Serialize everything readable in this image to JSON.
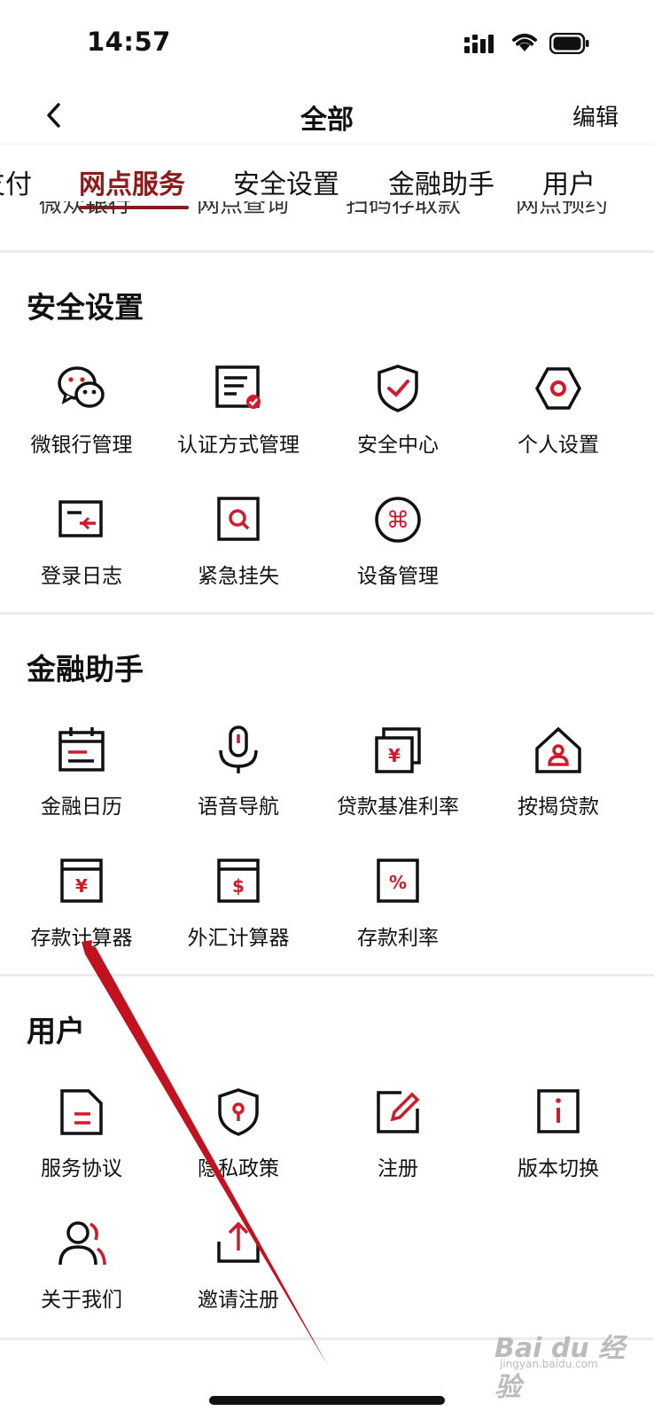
{
  "status_bar": {
    "time": "14:57"
  },
  "nav": {
    "title": "全部",
    "edit_label": "编辑"
  },
  "tabs": [
    {
      "label": "支付"
    },
    {
      "label": "网点服务"
    },
    {
      "label": "安全设置"
    },
    {
      "label": "金融助手"
    },
    {
      "label": "用户"
    }
  ],
  "peek_items": [
    {
      "label": "微众银行"
    },
    {
      "label": "网点查询"
    },
    {
      "label": "扫码存取款"
    },
    {
      "label": "网点预约"
    }
  ],
  "sections": {
    "security": {
      "title": "安全设置",
      "items": [
        {
          "label": "微银行管理"
        },
        {
          "label": "认证方式管理"
        },
        {
          "label": "安全中心"
        },
        {
          "label": "个人设置"
        },
        {
          "label": "登录日志"
        },
        {
          "label": "紧急挂失"
        },
        {
          "label": "设备管理"
        }
      ]
    },
    "finance": {
      "title": "金融助手",
      "items": [
        {
          "label": "金融日历"
        },
        {
          "label": "语音导航"
        },
        {
          "label": "贷款基准利率"
        },
        {
          "label": "按揭贷款"
        },
        {
          "label": "存款计算器"
        },
        {
          "label": "外汇计算器"
        },
        {
          "label": "存款利率"
        }
      ]
    },
    "user": {
      "title": "用户",
      "items": [
        {
          "label": "服务协议"
        },
        {
          "label": "隐私政策"
        },
        {
          "label": "注册"
        },
        {
          "label": "版本切换"
        },
        {
          "label": "关于我们"
        },
        {
          "label": "邀请注册"
        }
      ]
    }
  },
  "colors": {
    "accent": "#8e1a1a",
    "accent_bright": "#d11a2a",
    "divider": "#ececec"
  },
  "watermark": {
    "brand": "Bai du 经验",
    "sub": "jingyan.baidu.com"
  }
}
